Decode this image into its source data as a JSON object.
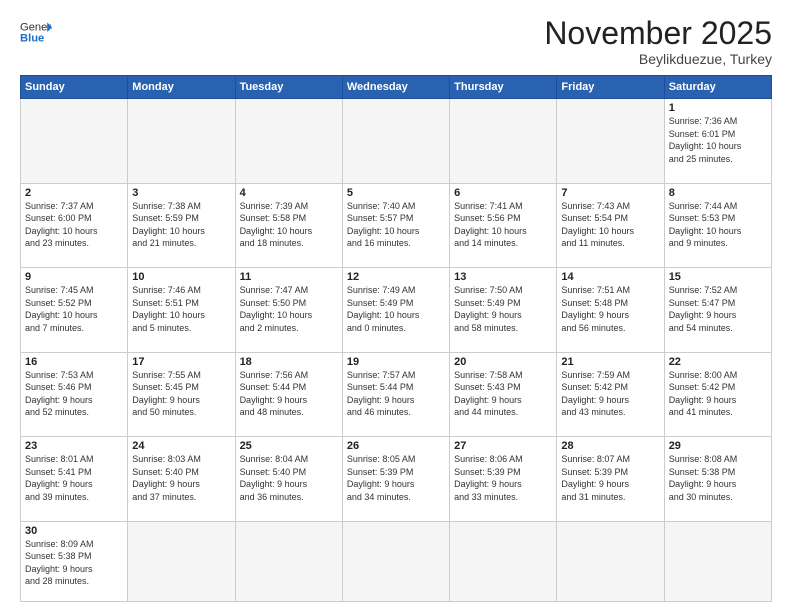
{
  "header": {
    "logo_general": "General",
    "logo_blue": "Blue",
    "month_title": "November 2025",
    "location": "Beylikduezue, Turkey"
  },
  "weekdays": [
    "Sunday",
    "Monday",
    "Tuesday",
    "Wednesday",
    "Thursday",
    "Friday",
    "Saturday"
  ],
  "weeks": [
    [
      {
        "day": "",
        "info": "",
        "empty": true
      },
      {
        "day": "",
        "info": "",
        "empty": true
      },
      {
        "day": "",
        "info": "",
        "empty": true
      },
      {
        "day": "",
        "info": "",
        "empty": true
      },
      {
        "day": "",
        "info": "",
        "empty": true
      },
      {
        "day": "",
        "info": "",
        "empty": true
      },
      {
        "day": "1",
        "info": "Sunrise: 7:36 AM\nSunset: 6:01 PM\nDaylight: 10 hours\nand 25 minutes."
      }
    ],
    [
      {
        "day": "2",
        "info": "Sunrise: 7:37 AM\nSunset: 6:00 PM\nDaylight: 10 hours\nand 23 minutes."
      },
      {
        "day": "3",
        "info": "Sunrise: 7:38 AM\nSunset: 5:59 PM\nDaylight: 10 hours\nand 21 minutes."
      },
      {
        "day": "4",
        "info": "Sunrise: 7:39 AM\nSunset: 5:58 PM\nDaylight: 10 hours\nand 18 minutes."
      },
      {
        "day": "5",
        "info": "Sunrise: 7:40 AM\nSunset: 5:57 PM\nDaylight: 10 hours\nand 16 minutes."
      },
      {
        "day": "6",
        "info": "Sunrise: 7:41 AM\nSunset: 5:56 PM\nDaylight: 10 hours\nand 14 minutes."
      },
      {
        "day": "7",
        "info": "Sunrise: 7:43 AM\nSunset: 5:54 PM\nDaylight: 10 hours\nand 11 minutes."
      },
      {
        "day": "8",
        "info": "Sunrise: 7:44 AM\nSunset: 5:53 PM\nDaylight: 10 hours\nand 9 minutes."
      }
    ],
    [
      {
        "day": "9",
        "info": "Sunrise: 7:45 AM\nSunset: 5:52 PM\nDaylight: 10 hours\nand 7 minutes."
      },
      {
        "day": "10",
        "info": "Sunrise: 7:46 AM\nSunset: 5:51 PM\nDaylight: 10 hours\nand 5 minutes."
      },
      {
        "day": "11",
        "info": "Sunrise: 7:47 AM\nSunset: 5:50 PM\nDaylight: 10 hours\nand 2 minutes."
      },
      {
        "day": "12",
        "info": "Sunrise: 7:49 AM\nSunset: 5:49 PM\nDaylight: 10 hours\nand 0 minutes."
      },
      {
        "day": "13",
        "info": "Sunrise: 7:50 AM\nSunset: 5:49 PM\nDaylight: 9 hours\nand 58 minutes."
      },
      {
        "day": "14",
        "info": "Sunrise: 7:51 AM\nSunset: 5:48 PM\nDaylight: 9 hours\nand 56 minutes."
      },
      {
        "day": "15",
        "info": "Sunrise: 7:52 AM\nSunset: 5:47 PM\nDaylight: 9 hours\nand 54 minutes."
      }
    ],
    [
      {
        "day": "16",
        "info": "Sunrise: 7:53 AM\nSunset: 5:46 PM\nDaylight: 9 hours\nand 52 minutes."
      },
      {
        "day": "17",
        "info": "Sunrise: 7:55 AM\nSunset: 5:45 PM\nDaylight: 9 hours\nand 50 minutes."
      },
      {
        "day": "18",
        "info": "Sunrise: 7:56 AM\nSunset: 5:44 PM\nDaylight: 9 hours\nand 48 minutes."
      },
      {
        "day": "19",
        "info": "Sunrise: 7:57 AM\nSunset: 5:44 PM\nDaylight: 9 hours\nand 46 minutes."
      },
      {
        "day": "20",
        "info": "Sunrise: 7:58 AM\nSunset: 5:43 PM\nDaylight: 9 hours\nand 44 minutes."
      },
      {
        "day": "21",
        "info": "Sunrise: 7:59 AM\nSunset: 5:42 PM\nDaylight: 9 hours\nand 43 minutes."
      },
      {
        "day": "22",
        "info": "Sunrise: 8:00 AM\nSunset: 5:42 PM\nDaylight: 9 hours\nand 41 minutes."
      }
    ],
    [
      {
        "day": "23",
        "info": "Sunrise: 8:01 AM\nSunset: 5:41 PM\nDaylight: 9 hours\nand 39 minutes."
      },
      {
        "day": "24",
        "info": "Sunrise: 8:03 AM\nSunset: 5:40 PM\nDaylight: 9 hours\nand 37 minutes."
      },
      {
        "day": "25",
        "info": "Sunrise: 8:04 AM\nSunset: 5:40 PM\nDaylight: 9 hours\nand 36 minutes."
      },
      {
        "day": "26",
        "info": "Sunrise: 8:05 AM\nSunset: 5:39 PM\nDaylight: 9 hours\nand 34 minutes."
      },
      {
        "day": "27",
        "info": "Sunrise: 8:06 AM\nSunset: 5:39 PM\nDaylight: 9 hours\nand 33 minutes."
      },
      {
        "day": "28",
        "info": "Sunrise: 8:07 AM\nSunset: 5:39 PM\nDaylight: 9 hours\nand 31 minutes."
      },
      {
        "day": "29",
        "info": "Sunrise: 8:08 AM\nSunset: 5:38 PM\nDaylight: 9 hours\nand 30 minutes."
      }
    ],
    [
      {
        "day": "30",
        "info": "Sunrise: 8:09 AM\nSunset: 5:38 PM\nDaylight: 9 hours\nand 28 minutes."
      },
      {
        "day": "",
        "info": "",
        "empty": true
      },
      {
        "day": "",
        "info": "",
        "empty": true
      },
      {
        "day": "",
        "info": "",
        "empty": true
      },
      {
        "day": "",
        "info": "",
        "empty": true
      },
      {
        "day": "",
        "info": "",
        "empty": true
      },
      {
        "day": "",
        "info": "",
        "empty": true
      }
    ]
  ]
}
